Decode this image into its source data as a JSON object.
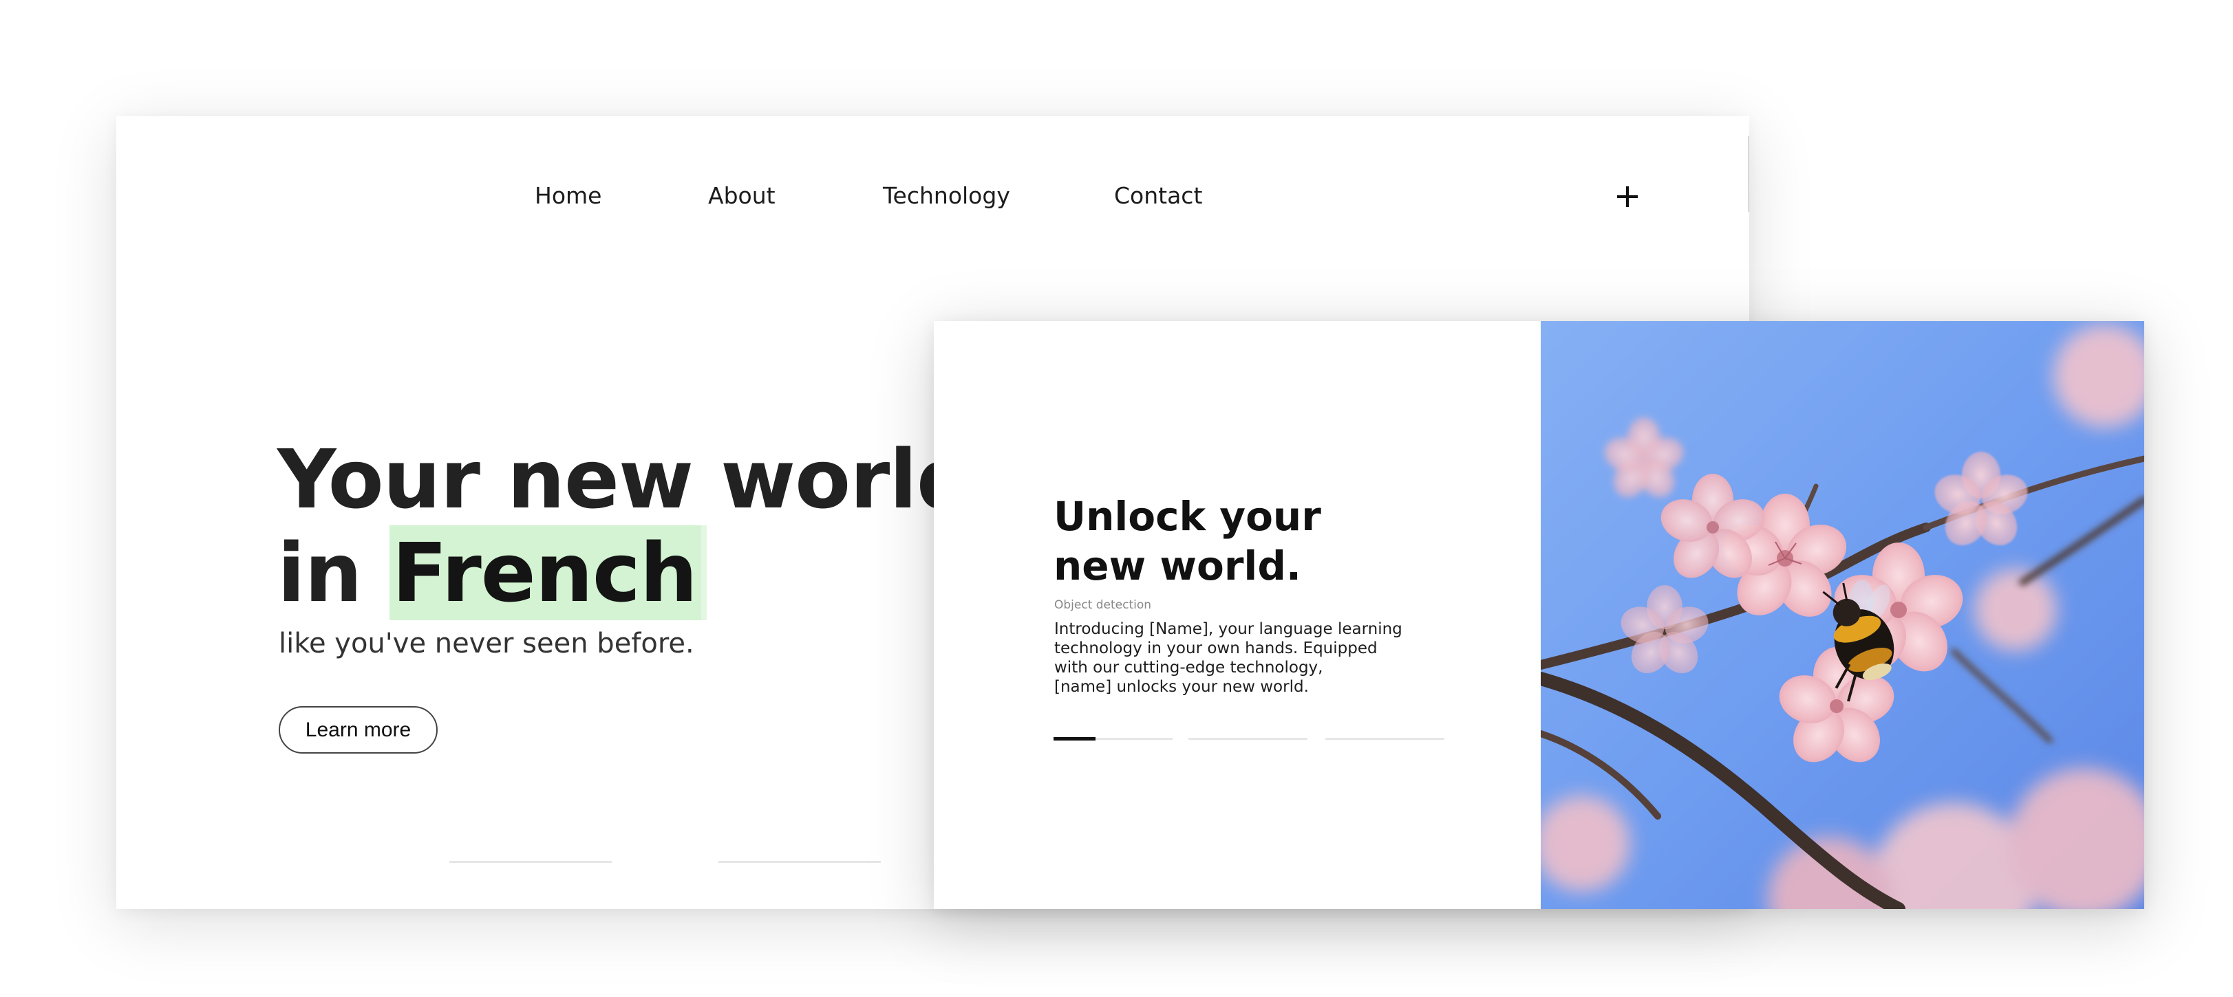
{
  "nav": {
    "items": [
      {
        "label": "Home"
      },
      {
        "label": "About"
      },
      {
        "label": "Technology"
      },
      {
        "label": "Contact"
      }
    ],
    "menu_icon": "plus-icon"
  },
  "hero": {
    "title_line1": "Your new world",
    "title_prefix": "in ",
    "title_highlight": "French",
    "subtitle": "like you've never seen before.",
    "button_label": "Learn more"
  },
  "feature": {
    "title_line1": "Unlock your",
    "title_line2": "new world.",
    "tag": "Object detection",
    "description_lines": [
      "Introducing [Name], your language learning",
      "technology in your own hands. Equipped",
      "with our cutting-edge technology,",
      "[name] unlocks your new world."
    ],
    "progress": {
      "segments": 3,
      "active_segment": 1,
      "active_fraction": 0.35
    },
    "image_subject": "bumblebee on pink cherry blossoms against blue sky"
  },
  "colors": {
    "highlight": "#d3f3d2",
    "text_dark": "#222222",
    "sky": "#6f9df0",
    "blossom": "#f3c7cf"
  }
}
